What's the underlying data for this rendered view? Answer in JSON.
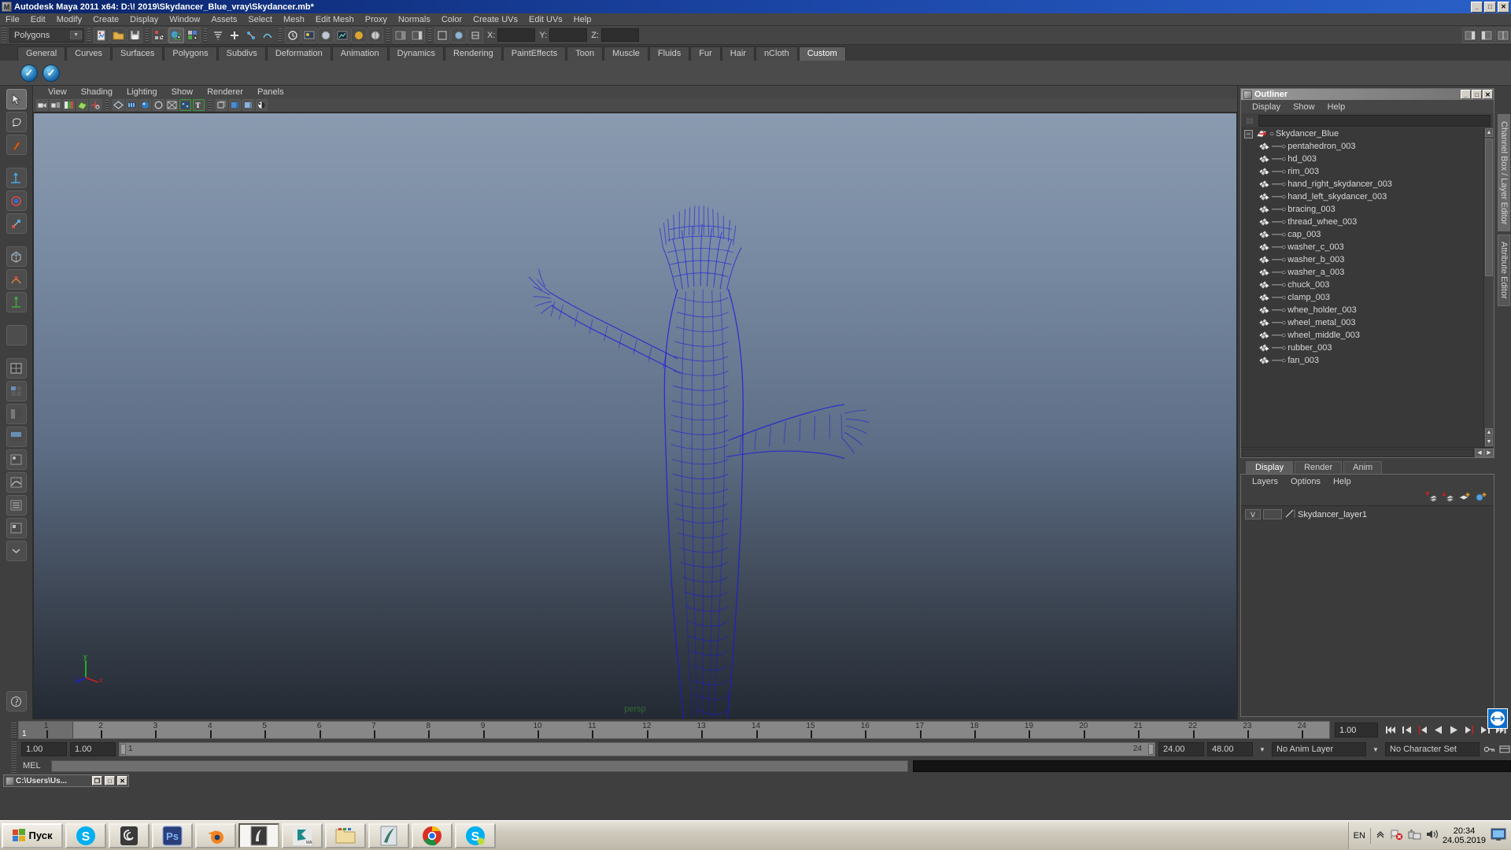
{
  "window": {
    "title": "Autodesk Maya 2011 x64: D:\\! 2019\\Skydancer_Blue_vray\\Skydancer.mb*",
    "app_icon": "maya-icon",
    "buttons": {
      "minimize": "_",
      "maximize": "□",
      "close": "✕"
    }
  },
  "menubar": {
    "items": [
      "File",
      "Edit",
      "Modify",
      "Create",
      "Display",
      "Window",
      "Assets",
      "Select",
      "Mesh",
      "Edit Mesh",
      "Proxy",
      "Normals",
      "Color",
      "Create UVs",
      "Edit UVs",
      "Help"
    ]
  },
  "statusline": {
    "mode_selector": {
      "value": "Polygons"
    },
    "coords": {
      "x_label": "X:",
      "y_label": "Y:",
      "z_label": "Z:",
      "x_value": "",
      "y_value": "",
      "z_value": ""
    }
  },
  "shelf": {
    "tabs": [
      "General",
      "Curves",
      "Surfaces",
      "Polygons",
      "Subdivs",
      "Deformation",
      "Animation",
      "Dynamics",
      "Rendering",
      "PaintEffects",
      "Toon",
      "Muscle",
      "Fluids",
      "Fur",
      "Hair",
      "nCloth",
      "Custom"
    ],
    "active_tab": "Custom",
    "buttons": [
      "check-blue-icon",
      "check-blue-icon"
    ]
  },
  "viewport": {
    "menus": [
      "View",
      "Shading",
      "Lighting",
      "Show",
      "Renderer",
      "Panels"
    ],
    "camera_label": "persp",
    "axis": {
      "x": "x",
      "y": "y",
      "z": "z",
      "x_color": "#cc2020",
      "y_color": "#20cc20",
      "z_color": "#2020cc"
    },
    "model_color": "#1a1ae0",
    "background_top": "#8a9bb0",
    "background_bottom": "#242a33"
  },
  "outliner": {
    "title": "Outliner",
    "menus": [
      "Display",
      "Show",
      "Help"
    ],
    "search_value": "",
    "root": {
      "label": "Skydancer_Blue",
      "icon": "transform-icon",
      "expanded": true
    },
    "items": [
      {
        "label": "pentahedron_003",
        "icon": "mesh-icon"
      },
      {
        "label": "hd_003",
        "icon": "mesh-icon"
      },
      {
        "label": "rim_003",
        "icon": "mesh-icon"
      },
      {
        "label": "hand_right_skydancer_003",
        "icon": "mesh-icon"
      },
      {
        "label": "hand_left_skydancer_003",
        "icon": "mesh-icon"
      },
      {
        "label": "bracing_003",
        "icon": "mesh-icon"
      },
      {
        "label": "thread_whee_003",
        "icon": "mesh-icon"
      },
      {
        "label": "cap_003",
        "icon": "mesh-icon"
      },
      {
        "label": "washer_c_003",
        "icon": "mesh-icon"
      },
      {
        "label": "washer_b_003",
        "icon": "mesh-icon"
      },
      {
        "label": "washer_a_003",
        "icon": "mesh-icon"
      },
      {
        "label": "chuck_003",
        "icon": "mesh-icon"
      },
      {
        "label": "clamp_003",
        "icon": "mesh-icon"
      },
      {
        "label": "whee_holder_003",
        "icon": "mesh-icon"
      },
      {
        "label": "wheel_metal_003",
        "icon": "mesh-icon"
      },
      {
        "label": "wheel_middle_003",
        "icon": "mesh-icon"
      },
      {
        "label": "rubber_003",
        "icon": "mesh-icon"
      },
      {
        "label": "fan_003",
        "icon": "mesh-icon"
      }
    ]
  },
  "layer_editor": {
    "tabs": [
      "Display",
      "Render",
      "Anim"
    ],
    "active_tab": "Display",
    "menus": [
      "Layers",
      "Options",
      "Help"
    ],
    "toolbar_icons": [
      "move-layer-up-icon",
      "move-layer-down-icon",
      "new-layer-icon",
      "new-layer-from-selected-icon"
    ],
    "layers": [
      {
        "visibility": "V",
        "shading": "",
        "name": "Skydancer_layer1"
      }
    ]
  },
  "side_tabs": {
    "items": [
      {
        "label": "Channel Box / Layer Editor",
        "active": true
      },
      {
        "label": "Attribute Editor",
        "active": false
      }
    ]
  },
  "time_slider": {
    "start_tick": 1,
    "end_tick": 24,
    "ticks": [
      1,
      2,
      3,
      4,
      5,
      6,
      7,
      8,
      9,
      10,
      11,
      12,
      13,
      14,
      15,
      16,
      17,
      18,
      19,
      20,
      21,
      22,
      23,
      24
    ],
    "current_frame_label": "1",
    "current_time_value": "1.00",
    "playback_buttons": [
      "go-to-start-icon",
      "step-back-keyframe-icon",
      "step-back-frame-icon",
      "play-backwards-icon",
      "play-forwards-icon",
      "step-forward-frame-icon",
      "step-forward-keyframe-icon",
      "go-to-end-icon"
    ]
  },
  "range_slider": {
    "anim_start": "1.00",
    "range_start": "1.00",
    "bar_start_label": "1",
    "bar_end_label": "24",
    "range_end": "24.00",
    "anim_end": "48.00",
    "anim_layer": "No Anim Layer",
    "character_set": "No Character Set"
  },
  "command_line": {
    "label": "MEL",
    "input_value": "",
    "output_value": ""
  },
  "mini_task": {
    "title": "C:\\Users\\Us...",
    "buttons": {
      "restore": "❐",
      "maximize": "□",
      "close": "✕"
    }
  },
  "taskbar": {
    "start_label": "Пуск",
    "apps": [
      {
        "name": "skype-taskbar-icon",
        "active": false
      },
      {
        "name": "spiral-app-taskbar-icon",
        "active": false
      },
      {
        "name": "photoshop-taskbar-icon",
        "active": false
      },
      {
        "name": "blender-taskbar-icon",
        "active": false
      },
      {
        "name": "maya-taskbar-icon",
        "active": true
      },
      {
        "name": "3dsmax-taskbar-icon",
        "active": false
      },
      {
        "name": "explorer-taskbar-icon",
        "active": false
      },
      {
        "name": "quill-app-taskbar-icon",
        "active": false
      },
      {
        "name": "chrome-taskbar-icon",
        "active": false
      },
      {
        "name": "skype2-taskbar-icon",
        "active": false
      }
    ],
    "tray": {
      "language": "EN",
      "icons": [
        "show-hidden-icons-chevron",
        "network-error-icon",
        "removable-media-icon",
        "volume-icon"
      ],
      "time": "20:34",
      "date": "24.05.2019",
      "rightmost_icon": "display-icon"
    }
  }
}
